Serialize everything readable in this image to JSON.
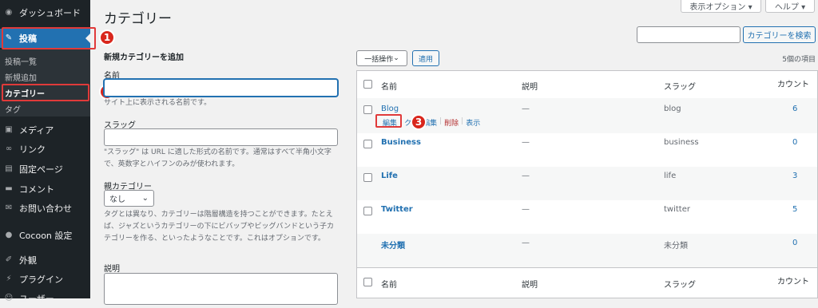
{
  "sidebar": {
    "items": [
      {
        "label": "ダッシュボード",
        "icon": "dashboard-icon"
      },
      {
        "label": "投稿",
        "icon": "pin-icon"
      },
      {
        "label": "メディア",
        "icon": "media-icon"
      },
      {
        "label": "リンク",
        "icon": "link-icon"
      },
      {
        "label": "固定ページ",
        "icon": "page-icon"
      },
      {
        "label": "コメント",
        "icon": "comment-icon"
      },
      {
        "label": "お問い合わせ",
        "icon": "mail-icon"
      },
      {
        "label": "Cocoon 設定",
        "icon": "circle-icon"
      },
      {
        "label": "外観",
        "icon": "brush-icon"
      },
      {
        "label": "プラグイン",
        "icon": "plug-icon"
      },
      {
        "label": "ユーザー",
        "icon": "user-icon"
      }
    ],
    "submenu": [
      "投稿一覧",
      "新規追加",
      "カテゴリー",
      "タグ"
    ]
  },
  "badges": [
    "1",
    "2",
    "3"
  ],
  "header": {
    "title": "カテゴリー",
    "screen_options": "表示オプション ▾",
    "help": "ヘルプ ▾"
  },
  "search": {
    "button": "カテゴリーを検索",
    "value": ""
  },
  "form": {
    "heading": "新規カテゴリーを追加",
    "name_label": "名前",
    "name_desc": "サイト上に表示される名前です。",
    "slug_label": "スラッグ",
    "slug_desc": "\"スラッグ\" は URL に適した形式の名前です。通常はすべて半角小文字で、英数字とハイフンのみが使われます。",
    "parent_label": "親カテゴリー",
    "parent_value": "なし",
    "parent_desc": "タグとは異なり、カテゴリーは階層構造を持つことができます。たとえば、ジャズというカテゴリーの下にビバップやビッグバンドという子カテゴリーを作る、といったようなことです。これはオプションです。",
    "desc_label": "説明"
  },
  "table": {
    "bulk": "一括操作",
    "apply": "適用",
    "count_text": "5個の項目",
    "headers": {
      "name": "名前",
      "desc": "説明",
      "slug": "スラッグ",
      "count": "カウント"
    },
    "rows": [
      {
        "name": "Blog",
        "desc": "—",
        "slug": "blog",
        "count": "6"
      },
      {
        "name": "Business",
        "desc": "—",
        "slug": "business",
        "count": "0"
      },
      {
        "name": "Life",
        "desc": "—",
        "slug": "life",
        "count": "3"
      },
      {
        "name": "Twitter",
        "desc": "—",
        "slug": "twitter",
        "count": "5"
      },
      {
        "name": "未分類",
        "desc": "—",
        "slug": "未分類",
        "count": "0"
      }
    ],
    "row_actions": {
      "edit": "編集",
      "quick": "ク",
      "quick_edit": "編集",
      "delete": "削除",
      "view": "表示"
    }
  },
  "colors": {
    "sidebar": "#1d2327",
    "accent": "#2271b1",
    "highlight": "#e03a3a",
    "badge": "#d9261c"
  }
}
